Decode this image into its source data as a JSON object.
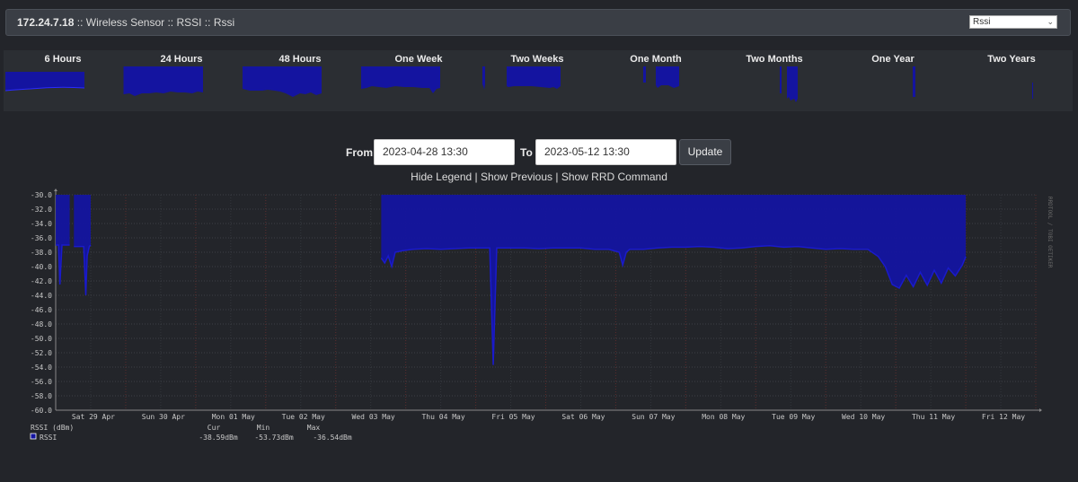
{
  "header": {
    "host": "172.24.7.18",
    "separator": " :: ",
    "device": "Wireless Sensor",
    "graph_group": "RSSI",
    "graph_name": "Rssi",
    "datasource_select": "Rssi"
  },
  "thumbnails": [
    {
      "label": "6 Hours"
    },
    {
      "label": "24 Hours"
    },
    {
      "label": "48 Hours"
    },
    {
      "label": "One Week"
    },
    {
      "label": "Two Weeks"
    },
    {
      "label": "One Month"
    },
    {
      "label": "Two Months"
    },
    {
      "label": "One Year"
    },
    {
      "label": "Two Years"
    }
  ],
  "controls": {
    "from_label": "From",
    "from_value": "2023-04-28 13:30",
    "to_label": "To",
    "to_value": "2023-05-12 13:30",
    "update_label": "Update"
  },
  "links": {
    "hide_legend": "Hide Legend",
    "show_previous": "Show Previous",
    "show_rrd": "Show RRD Command",
    "sep": " | "
  },
  "colors": {
    "series": "#1414a0",
    "series_line": "#1a1acc",
    "background": "#23252a",
    "grid": "#3a3c42"
  },
  "chart_data": {
    "type": "area",
    "watermark": "RRDTOOL / TOBI OETIKER",
    "ylim": [
      -60,
      -30
    ],
    "yticks": [
      "-30.0",
      "-32.0",
      "-34.0",
      "-36.0",
      "-38.0",
      "-40.0",
      "-42.0",
      "-44.0",
      "-46.0",
      "-48.0",
      "-50.0",
      "-52.0",
      "-54.0",
      "-56.0",
      "-58.0",
      "-60.0"
    ],
    "xticks": [
      "Sat 29 Apr",
      "Sun 30 Apr",
      "Mon 01 May",
      "Tue 02 May",
      "Wed 03 May",
      "Thu 04 May",
      "Fri 05 May",
      "Sat 06 May",
      "Sun 07 May",
      "Mon 08 May",
      "Tue 09 May",
      "Wed 10 May",
      "Thu 11 May",
      "Fri 12 May"
    ],
    "series": [
      {
        "name": "RSSI",
        "segments": [
          {
            "x": [
              0.0,
              0.04,
              0.06,
              0.09,
              0.12,
              0.14,
              0.17,
              0.2
            ],
            "y": [
              -37.0,
              -37.0,
              -42.5,
              -37.0,
              -37.0,
              -37.0,
              -37.0,
              -37.0
            ]
          },
          {
            "x": [
              0.26,
              0.35,
              0.38,
              0.4,
              0.43,
              0.45,
              0.48,
              0.5
            ],
            "y": [
              -37.2,
              -37.2,
              -37.2,
              -37.2,
              -44.0,
              -38.5,
              -37.2,
              -37.0
            ]
          },
          {
            "x": [
              4.65,
              4.7,
              4.75,
              4.8,
              4.85,
              4.95,
              5.1,
              5.3,
              5.5,
              5.7,
              5.9,
              6.1,
              6.2,
              6.25,
              6.3,
              6.5,
              6.7,
              6.9,
              7.1,
              7.3,
              7.5,
              7.7,
              7.9,
              8.05,
              8.1,
              8.15,
              8.2,
              8.4,
              8.6,
              8.8,
              9.0,
              9.2,
              9.4,
              9.6,
              9.8,
              10.0,
              10.2,
              10.4,
              10.6,
              10.8,
              11.0,
              11.2,
              11.4,
              11.6,
              11.75,
              11.85,
              11.95,
              12.05,
              12.15,
              12.25,
              12.35,
              12.45,
              12.55,
              12.65,
              12.75,
              12.85,
              12.95,
              13.0
            ],
            "y": [
              -38.8,
              -39.5,
              -38.5,
              -40.0,
              -38.0,
              -37.8,
              -37.6,
              -37.5,
              -37.6,
              -37.5,
              -37.4,
              -37.4,
              -37.4,
              -53.7,
              -37.4,
              -37.4,
              -37.4,
              -37.5,
              -37.4,
              -37.4,
              -37.4,
              -37.6,
              -37.6,
              -38.0,
              -39.8,
              -38.0,
              -37.6,
              -37.6,
              -37.4,
              -37.3,
              -37.3,
              -37.2,
              -37.3,
              -37.5,
              -37.4,
              -37.2,
              -37.1,
              -37.3,
              -37.2,
              -37.4,
              -37.6,
              -37.5,
              -37.6,
              -37.6,
              -38.6,
              -40.0,
              -42.5,
              -43.0,
              -41.2,
              -42.8,
              -40.8,
              -42.6,
              -40.5,
              -42.3,
              -40.2,
              -41.3,
              -39.8,
              -38.6
            ]
          }
        ]
      }
    ],
    "legend": {
      "title": "RSSI (dBm)",
      "headers": [
        "Cur",
        "Min",
        "Max"
      ],
      "entries": [
        {
          "name": "RSSI",
          "cur": "-38.59dBm",
          "min": "-53.73dBm",
          "max": "-36.54dBm"
        }
      ]
    }
  }
}
